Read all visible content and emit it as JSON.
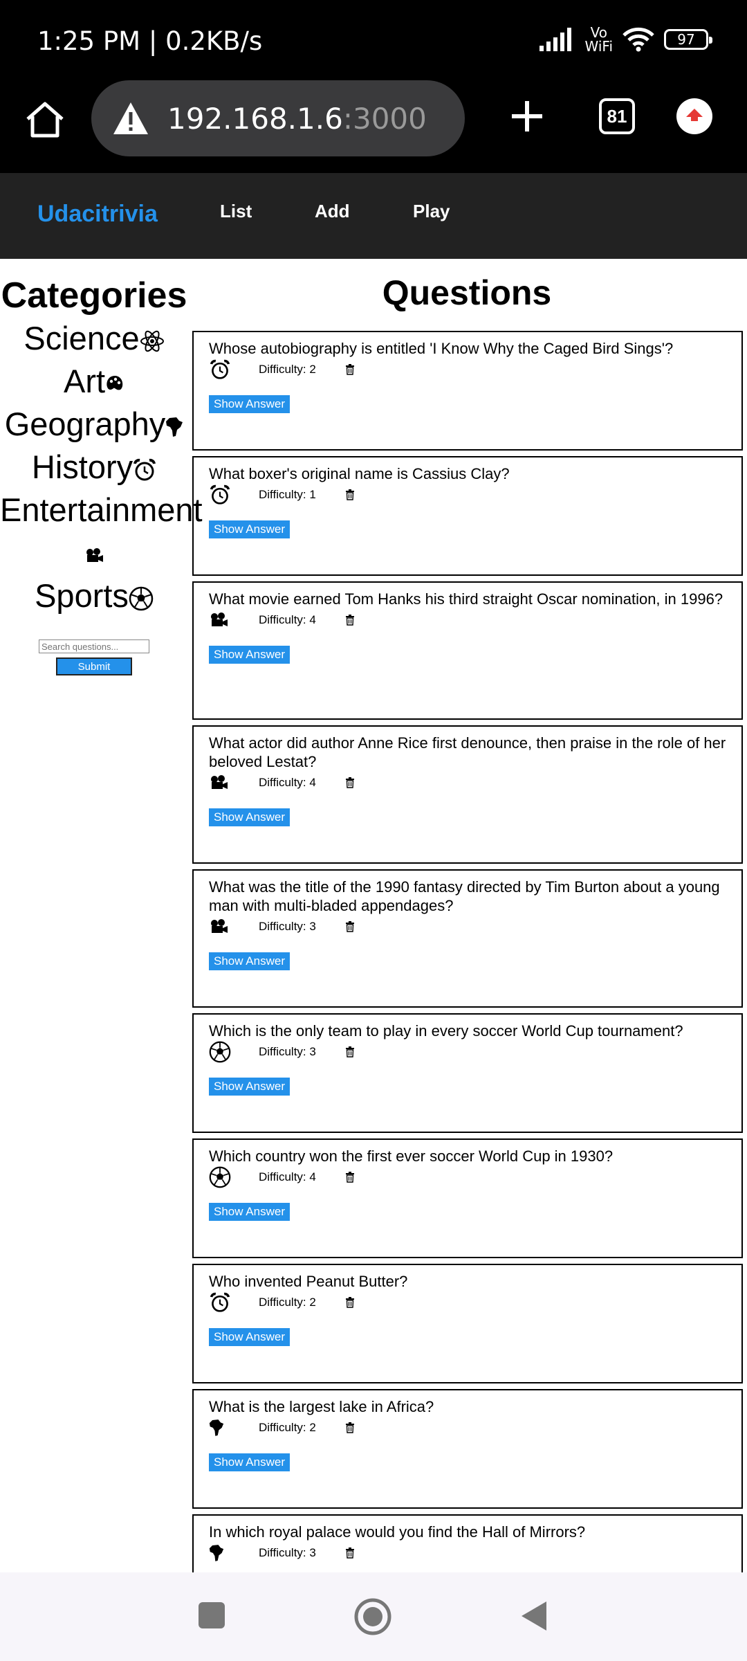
{
  "status": {
    "time": "1:25 PM | 0.2KB/s",
    "vowifi_top": "Vo",
    "vowifi_bottom": "WiFi",
    "battery": "97"
  },
  "browser": {
    "url_host": "192.168.1.6",
    "url_port": ":3000",
    "tab_count": "81"
  },
  "nav": {
    "brand": "Udacitrivia",
    "links": [
      "List",
      "Add",
      "Play"
    ]
  },
  "categories": {
    "title": "Categories",
    "items": [
      {
        "label": "Science",
        "icon": "atom-icon"
      },
      {
        "label": "Art",
        "icon": "palette-icon"
      },
      {
        "label": "Geography",
        "icon": "africa-icon"
      },
      {
        "label": "History",
        "icon": "alarm-clock-icon"
      },
      {
        "label": "Entertainment",
        "icon": "film-camera-icon"
      },
      {
        "label": "Sports",
        "icon": "soccer-ball-icon"
      }
    ],
    "search_placeholder": "Search questions...",
    "submit_label": "Submit"
  },
  "questions": {
    "title": "Questions",
    "show_answer_label": "Show Answer",
    "items": [
      {
        "text": "Whose autobiography is entitled 'I Know Why the Caged Bird Sings'?",
        "difficulty": "Difficulty: 2",
        "icon": "history"
      },
      {
        "text": "What boxer's original name is Cassius Clay?",
        "difficulty": "Difficulty: 1",
        "icon": "history"
      },
      {
        "text": "What movie earned Tom Hanks his third straight Oscar nomination, in 1996?",
        "difficulty": "Difficulty: 4",
        "icon": "entertainment"
      },
      {
        "text": "What actor did author Anne Rice first denounce, then praise in the role of her beloved Lestat?",
        "difficulty": "Difficulty: 4",
        "icon": "entertainment"
      },
      {
        "text": "What was the title of the 1990 fantasy directed by Tim Burton about a young man with multi-bladed appendages?",
        "difficulty": "Difficulty: 3",
        "icon": "entertainment"
      },
      {
        "text": "Which is the only team to play in every soccer World Cup tournament?",
        "difficulty": "Difficulty: 3",
        "icon": "sports"
      },
      {
        "text": "Which country won the first ever soccer World Cup in 1930?",
        "difficulty": "Difficulty: 4",
        "icon": "sports"
      },
      {
        "text": "Who invented Peanut Butter?",
        "difficulty": "Difficulty: 2",
        "icon": "history"
      },
      {
        "text": "What is the largest lake in Africa?",
        "difficulty": "Difficulty: 2",
        "icon": "geography"
      },
      {
        "text": "In which royal palace would you find the Hall of Mirrors?",
        "difficulty": "Difficulty: 3",
        "icon": "geography"
      }
    ]
  },
  "colors": {
    "accent": "#2491ea",
    "navbar": "#222222",
    "statusbar": "#000000",
    "url_pill": "#3a3a3c",
    "upload": "#e53935"
  }
}
